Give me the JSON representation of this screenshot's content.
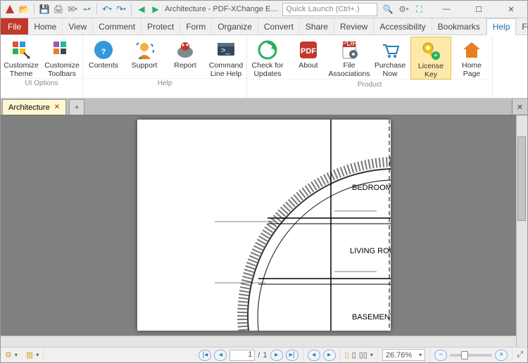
{
  "title": "Architecture - PDF-XChange E…",
  "search_placeholder": "Quick Launch (Ctrl+.)",
  "menu": {
    "file": "File",
    "tabs": [
      "Home",
      "View",
      "Comment",
      "Protect",
      "Form",
      "Organize",
      "Convert",
      "Share",
      "Review",
      "Accessibility",
      "Bookmarks",
      "Help",
      "Format"
    ],
    "active": "Help"
  },
  "ribbon": {
    "groups": [
      {
        "label": "UI Options",
        "items": [
          {
            "k": "customize-theme",
            "label": "Customize Theme"
          },
          {
            "k": "customize-toolbars",
            "label": "Customize Toolbars"
          }
        ]
      },
      {
        "label": "Help",
        "items": [
          {
            "k": "contents",
            "label": "Contents"
          },
          {
            "k": "support",
            "label": "Support"
          },
          {
            "k": "report",
            "label": "Report"
          },
          {
            "k": "cmdline",
            "label": "Command Line Help"
          }
        ]
      },
      {
        "label": "Product",
        "items": [
          {
            "k": "updates",
            "label": "Check for Updates"
          },
          {
            "k": "about",
            "label": "About"
          },
          {
            "k": "fileassoc",
            "label": "File Associations"
          },
          {
            "k": "purchase",
            "label": "Purchase Now"
          },
          {
            "k": "license",
            "label": "License Key",
            "hl": true
          },
          {
            "k": "homepage",
            "label": "Home Page"
          }
        ]
      }
    ]
  },
  "doctab": {
    "name": "Architecture"
  },
  "drawing": {
    "rooms": [
      "BEDROOMS",
      "LIVING ROOM",
      "BASEMENT"
    ]
  },
  "status": {
    "page_current": "1",
    "page_sep": "/",
    "page_total": "1",
    "zoom": "26.76%"
  }
}
